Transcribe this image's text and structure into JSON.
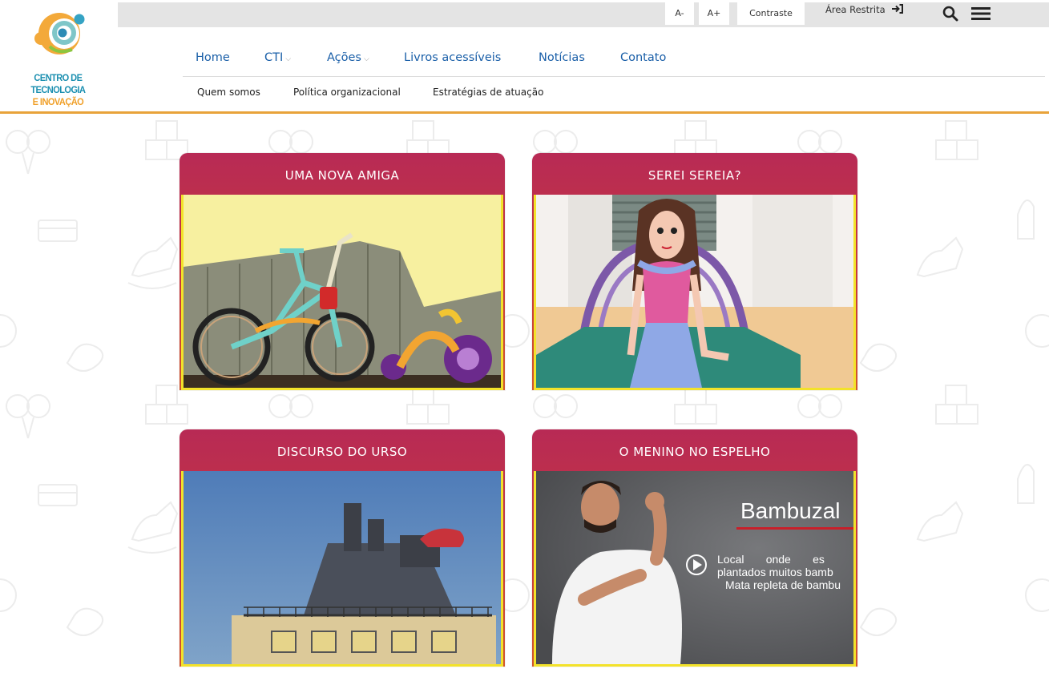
{
  "logo": {
    "line1": "CENTRO DE TECNOLOGIA",
    "line2": "E INOVAÇÃO"
  },
  "topbar": {
    "font_decrease": "A-",
    "font_increase": "A+",
    "contrast": "Contraste",
    "restricted_area": "Área Restrita"
  },
  "nav": {
    "items": [
      {
        "label": "Home"
      },
      {
        "label": "CTI"
      },
      {
        "label": "Ações"
      },
      {
        "label": "Livros acessíveis"
      },
      {
        "label": "Notícias"
      },
      {
        "label": "Contato"
      }
    ],
    "subitems": [
      {
        "label": "Quem somos"
      },
      {
        "label": "Política organizacional"
      },
      {
        "label": "Estratégias de atuação"
      }
    ]
  },
  "cards": [
    {
      "title": "UMA NOVA AMIGA"
    },
    {
      "title": "SEREI SEREIA?"
    },
    {
      "title": "DISCURSO DO URSO"
    },
    {
      "title": "O MENINO NO ESPELHO"
    }
  ],
  "video": {
    "word": "Bambuzal",
    "line1": "Local       onde       es",
    "line2": "plantados muitos bamb",
    "line3": "Mata repleta de bambu"
  },
  "colors": {
    "nav_link": "#1a5fa8",
    "card_header": "#c03447",
    "card_border": "#f3e22a",
    "header_rule": "#e8a33a"
  }
}
